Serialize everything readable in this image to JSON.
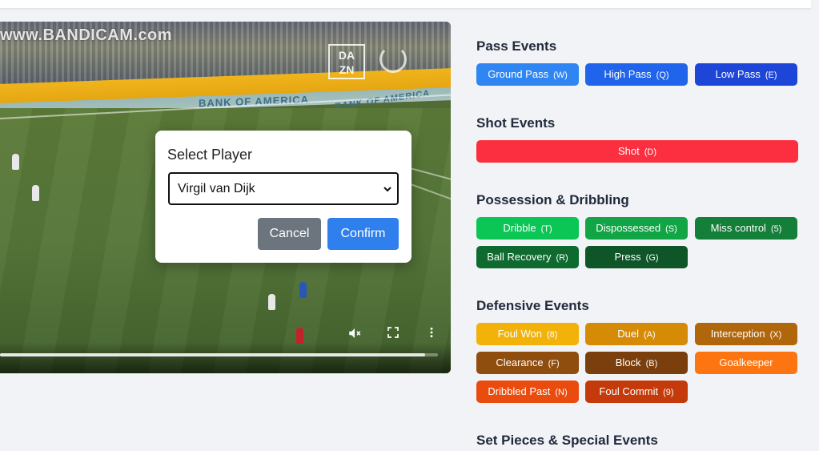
{
  "video": {
    "watermark": "www.BANDICAM.com",
    "broadcaster_logo": "DA\nZN",
    "ad_text_1": "BANK OF AMERICA",
    "ad_text_2": "BANK OF AMERICA",
    "progress_fraction": 0.97,
    "icons": [
      "mute-icon",
      "fullscreen-icon",
      "more-vert-icon",
      "loading-icon"
    ]
  },
  "modal": {
    "title": "Select Player",
    "selected_player": "Virgil van Dijk",
    "cancel_label": "Cancel",
    "confirm_label": "Confirm"
  },
  "sections": {
    "pass": {
      "title": "Pass Events",
      "buttons": [
        {
          "label": "Ground Pass",
          "key": "(W)",
          "color": "#2f86f3"
        },
        {
          "label": "High Pass",
          "key": "(Q)",
          "color": "#1f64ea"
        },
        {
          "label": "Low Pass",
          "key": "(E)",
          "color": "#1d46d8"
        }
      ]
    },
    "shot": {
      "title": "Shot Events",
      "buttons": [
        {
          "label": "Shot",
          "key": "(D)",
          "color": "#fb2f3f"
        }
      ]
    },
    "possession": {
      "title": "Possession & Dribbling",
      "buttons": [
        {
          "label": "Dribble",
          "key": "(T)",
          "color": "#0bc654"
        },
        {
          "label": "Dispossessed",
          "key": "(S)",
          "color": "#12a545"
        },
        {
          "label": "Miss control",
          "key": "(5)",
          "color": "#137f38"
        },
        {
          "label": "Ball Recovery",
          "key": "(R)",
          "color": "#0f6a30"
        },
        {
          "label": "Press",
          "key": "(G)",
          "color": "#0e5528"
        }
      ]
    },
    "defensive": {
      "title": "Defensive Events",
      "buttons": [
        {
          "label": "Foul Won",
          "key": "(8)",
          "color": "#f2b20a"
        },
        {
          "label": "Duel",
          "key": "(A)",
          "color": "#d68b07"
        },
        {
          "label": "Interception",
          "key": "(X)",
          "color": "#b0660a"
        },
        {
          "label": "Clearance",
          "key": "(F)",
          "color": "#8f4d0e"
        },
        {
          "label": "Block",
          "key": "(B)",
          "color": "#7a3f0d"
        },
        {
          "label": "Goalkeeper",
          "key": "",
          "color": "#fd7510"
        },
        {
          "label": "Dribbled Past",
          "key": "(N)",
          "color": "#ea4b0e"
        },
        {
          "label": "Foul Commit",
          "key": "(9)",
          "color": "#c43a0a"
        }
      ]
    },
    "setpieces": {
      "title": "Set Pieces & Special Events"
    }
  }
}
